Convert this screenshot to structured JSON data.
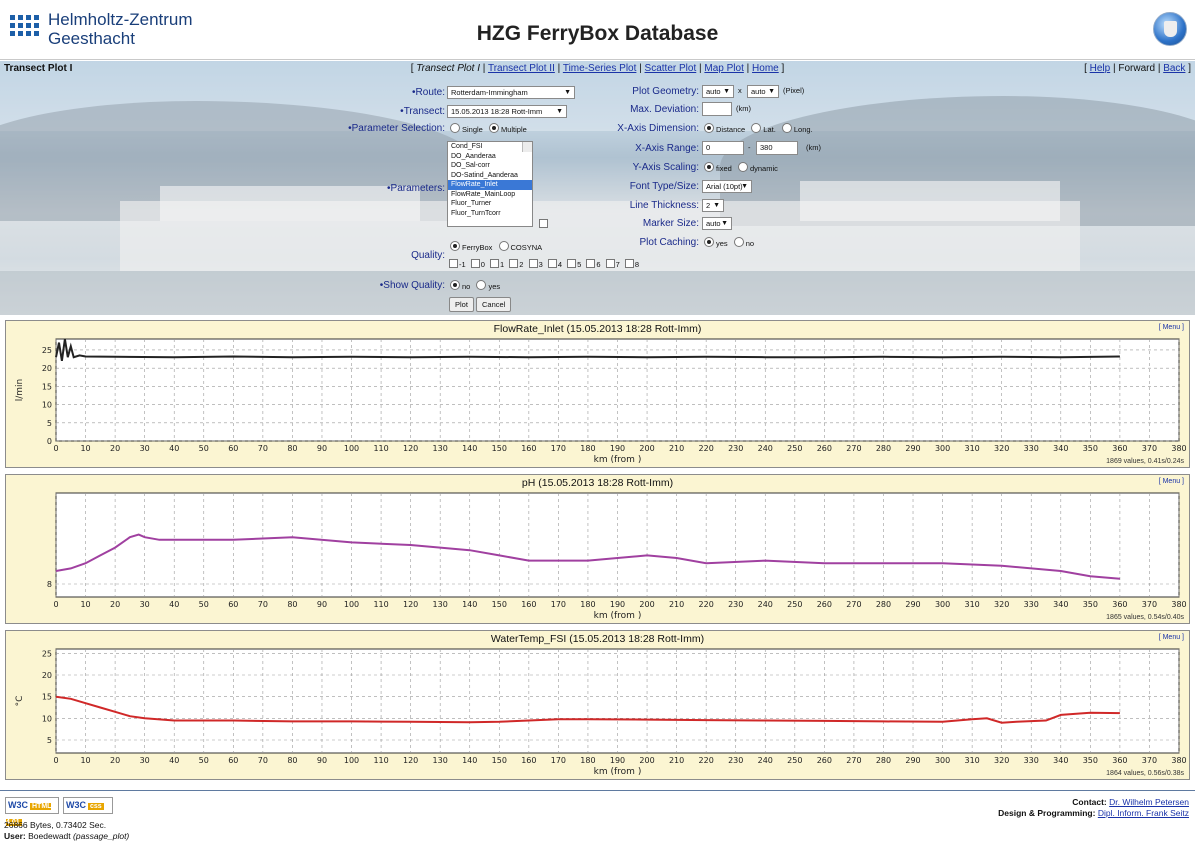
{
  "header": {
    "org_line1": "Helmholtz-Zentrum",
    "org_line2": "Geesthacht",
    "title": "HZG FerryBox Database"
  },
  "nav": {
    "page_name": "Transect Plot I",
    "current": "Transect Plot I",
    "links": [
      "Transect Plot II",
      "Time-Series Plot",
      "Scatter Plot",
      "Map Plot",
      "Home"
    ],
    "right_help": "Help",
    "right_forward": "Forward",
    "right_back": "Back"
  },
  "form": {
    "route_label": "Route:",
    "route_value": "Rotterdam-Immingham",
    "transect_label": "Transect:",
    "transect_value": "15.05.2013 18:28 Rott-Imm",
    "param_selection_label": "Parameter Selection:",
    "param_selection_opts": [
      "Single",
      "Multiple"
    ],
    "parameters_label": "Parameters:",
    "parameters": [
      "Cond_FSI",
      "DO_Aanderaa",
      "DO_Sal-corr",
      "DO-Satind_Aanderaa",
      "FlowRate_Inlet",
      "FlowRate_MainLoop",
      "Fluor_Turner",
      "Fluor_TurnTcorr"
    ],
    "parameters_selected": "FlowRate_Inlet",
    "source_opts": [
      "FerryBox",
      "COSYNA"
    ],
    "quality_label": "Quality:",
    "quality_values": [
      "-1",
      "0",
      "1",
      "2",
      "3",
      "4",
      "5",
      "6",
      "7",
      "8"
    ],
    "show_quality_label": "Show Quality:",
    "show_quality_opts": [
      "no",
      "yes"
    ],
    "plot_button": "Plot",
    "cancel_button": "Cancel",
    "geometry_label": "Plot Geometry:",
    "geometry_w": "auto",
    "geometry_x": "x",
    "geometry_h": "auto",
    "geometry_unit": "(Pixel)",
    "maxdev_label": "Max. Deviation:",
    "maxdev_unit": "(km)",
    "xdim_label": "X-Axis Dimension:",
    "xdim_opts": [
      "Distance",
      "Lat.",
      "Long."
    ],
    "xrange_label": "X-Axis Range:",
    "xrange_from": "0",
    "xrange_to": "380",
    "xrange_sep": "-",
    "xrange_unit": "(km)",
    "yscale_label": "Y-Axis Scaling:",
    "yscale_opts": [
      "fixed",
      "dynamic"
    ],
    "font_label": "Font Type/Size:",
    "font_value": "Arial (10pt)",
    "thickness_label": "Line Thickness:",
    "thickness_value": "2",
    "marker_label": "Marker Size:",
    "marker_value": "auto",
    "caching_label": "Plot Caching:",
    "caching_opts": [
      "yes",
      "no"
    ]
  },
  "plots": [
    {
      "title": "FlowRate_Inlet (15.05.2013 18:28 Rott-Imm)",
      "menu": "[ Menu ]",
      "footer": "1869 values, 0.41s/0.24s",
      "ylabel": "l/min",
      "xlabel": "km (from )"
    },
    {
      "title": "pH (15.05.2013 18:28 Rott-Imm)",
      "menu": "[ Menu ]",
      "footer": "1865 values, 0.54s/0.40s",
      "ylabel": "",
      "xlabel": "km (from )"
    },
    {
      "title": "WaterTemp_FSI (15.05.2013 18:28 Rott-Imm)",
      "menu": "[ Menu ]",
      "footer": "1864 values, 0.56s/0.38s",
      "ylabel": "°C",
      "xlabel": "km (from )"
    }
  ],
  "chart_data": [
    {
      "type": "line",
      "title": "FlowRate_Inlet (15.05.2013 18:28 Rott-Imm)",
      "xlabel": "km (from )",
      "ylabel": "l/min",
      "xlim": [
        0,
        380
      ],
      "ylim": [
        0,
        28
      ],
      "xticks": [
        0,
        10,
        20,
        30,
        40,
        50,
        60,
        70,
        80,
        90,
        100,
        110,
        120,
        130,
        140,
        150,
        160,
        170,
        180,
        190,
        200,
        210,
        220,
        230,
        240,
        250,
        260,
        270,
        280,
        290,
        300,
        310,
        320,
        330,
        340,
        350,
        360,
        370,
        380
      ],
      "yticks": [
        0,
        5,
        10,
        15,
        20,
        25
      ],
      "ytick_labels": [
        "0",
        "5",
        "10",
        "15",
        "20",
        "25"
      ],
      "grid": true,
      "color": "#222222",
      "series": [
        {
          "x": [
            0,
            1,
            2,
            3,
            4,
            5,
            6,
            8,
            10,
            20,
            40,
            60,
            80,
            100,
            120,
            140,
            160,
            180,
            200,
            220,
            240,
            260,
            280,
            300,
            320,
            340,
            360
          ],
          "y": [
            23,
            27,
            22,
            28,
            23,
            26,
            23,
            23.5,
            23.2,
            23.1,
            23,
            23.2,
            23,
            23.1,
            23,
            23.1,
            23,
            23.1,
            23,
            23.1,
            23,
            23,
            23.1,
            23,
            23.1,
            23,
            23.2
          ]
        }
      ]
    },
    {
      "type": "line",
      "title": "pH (15.05.2013 18:28 Rott-Imm)",
      "xlabel": "km (from )",
      "ylabel": "",
      "xlim": [
        0,
        380
      ],
      "ylim": [
        7.95,
        8.35
      ],
      "xticks": [
        0,
        10,
        20,
        30,
        40,
        50,
        60,
        70,
        80,
        90,
        100,
        110,
        120,
        130,
        140,
        150,
        160,
        170,
        180,
        190,
        200,
        210,
        220,
        230,
        240,
        250,
        260,
        270,
        280,
        290,
        300,
        310,
        320,
        330,
        340,
        350,
        360,
        370,
        380
      ],
      "yticks": [
        8
      ],
      "ytick_labels": [
        "8"
      ],
      "grid": true,
      "color": "#a040a0",
      "series": [
        {
          "x": [
            0,
            5,
            10,
            15,
            20,
            25,
            28,
            30,
            35,
            40,
            60,
            80,
            100,
            120,
            140,
            150,
            160,
            180,
            190,
            200,
            210,
            220,
            240,
            260,
            280,
            300,
            320,
            340,
            350,
            360
          ],
          "y": [
            8.05,
            8.06,
            8.08,
            8.11,
            8.14,
            8.18,
            8.19,
            8.18,
            8.17,
            8.17,
            8.17,
            8.18,
            8.16,
            8.15,
            8.13,
            8.11,
            8.09,
            8.09,
            8.1,
            8.11,
            8.1,
            8.08,
            8.09,
            8.08,
            8.08,
            8.08,
            8.07,
            8.05,
            8.03,
            8.02
          ]
        }
      ]
    },
    {
      "type": "line",
      "title": "WaterTemp_FSI (15.05.2013 18:28 Rott-Imm)",
      "xlabel": "km (from )",
      "ylabel": "°C",
      "xlim": [
        0,
        380
      ],
      "ylim": [
        2,
        26
      ],
      "xticks": [
        0,
        10,
        20,
        30,
        40,
        50,
        60,
        70,
        80,
        90,
        100,
        110,
        120,
        130,
        140,
        150,
        160,
        170,
        180,
        190,
        200,
        210,
        220,
        230,
        240,
        250,
        260,
        270,
        280,
        290,
        300,
        310,
        320,
        330,
        340,
        350,
        360,
        370,
        380
      ],
      "yticks": [
        5,
        10,
        15,
        20,
        25
      ],
      "ytick_labels": [
        "5",
        "10",
        "15",
        "20",
        "25"
      ],
      "grid": true,
      "color": "#d02828",
      "series": [
        {
          "x": [
            0,
            5,
            10,
            15,
            20,
            25,
            30,
            40,
            60,
            80,
            100,
            120,
            140,
            150,
            160,
            170,
            180,
            200,
            220,
            240,
            260,
            280,
            300,
            310,
            315,
            320,
            325,
            335,
            340,
            350,
            360
          ],
          "y": [
            15,
            14.5,
            13.5,
            12.5,
            11.5,
            10.5,
            10,
            9.5,
            9.5,
            9.3,
            9.3,
            9.2,
            9.1,
            9.2,
            9.5,
            9.8,
            9.8,
            9.7,
            9.6,
            9.5,
            9.4,
            9.3,
            9.2,
            9.8,
            10,
            9,
            9.2,
            9.5,
            10.8,
            11.3,
            11.2
          ]
        }
      ]
    }
  ],
  "footer": {
    "badge1_w3c": "W3C",
    "badge1_text": "HTML 4.01",
    "badge2_w3c": "W3C",
    "badge2_text": "css",
    "bytes": "26866 Bytes, 0.73402 Sec.",
    "user_label": "User:",
    "user_name": "Boedewadt",
    "user_extra": "(passage_plot)",
    "contact_label": "Contact:",
    "contact_name": "Dr. Wilhelm Petersen",
    "design_label": "Design & Programming:",
    "design_name": "Dipl. Inform. Frank Seitz"
  },
  "colors": {
    "panel_bg": "#fbf5d2",
    "link": "#1a33a8",
    "flow_line": "#222222",
    "ph_line": "#a040a0",
    "temp_line": "#d02828"
  }
}
